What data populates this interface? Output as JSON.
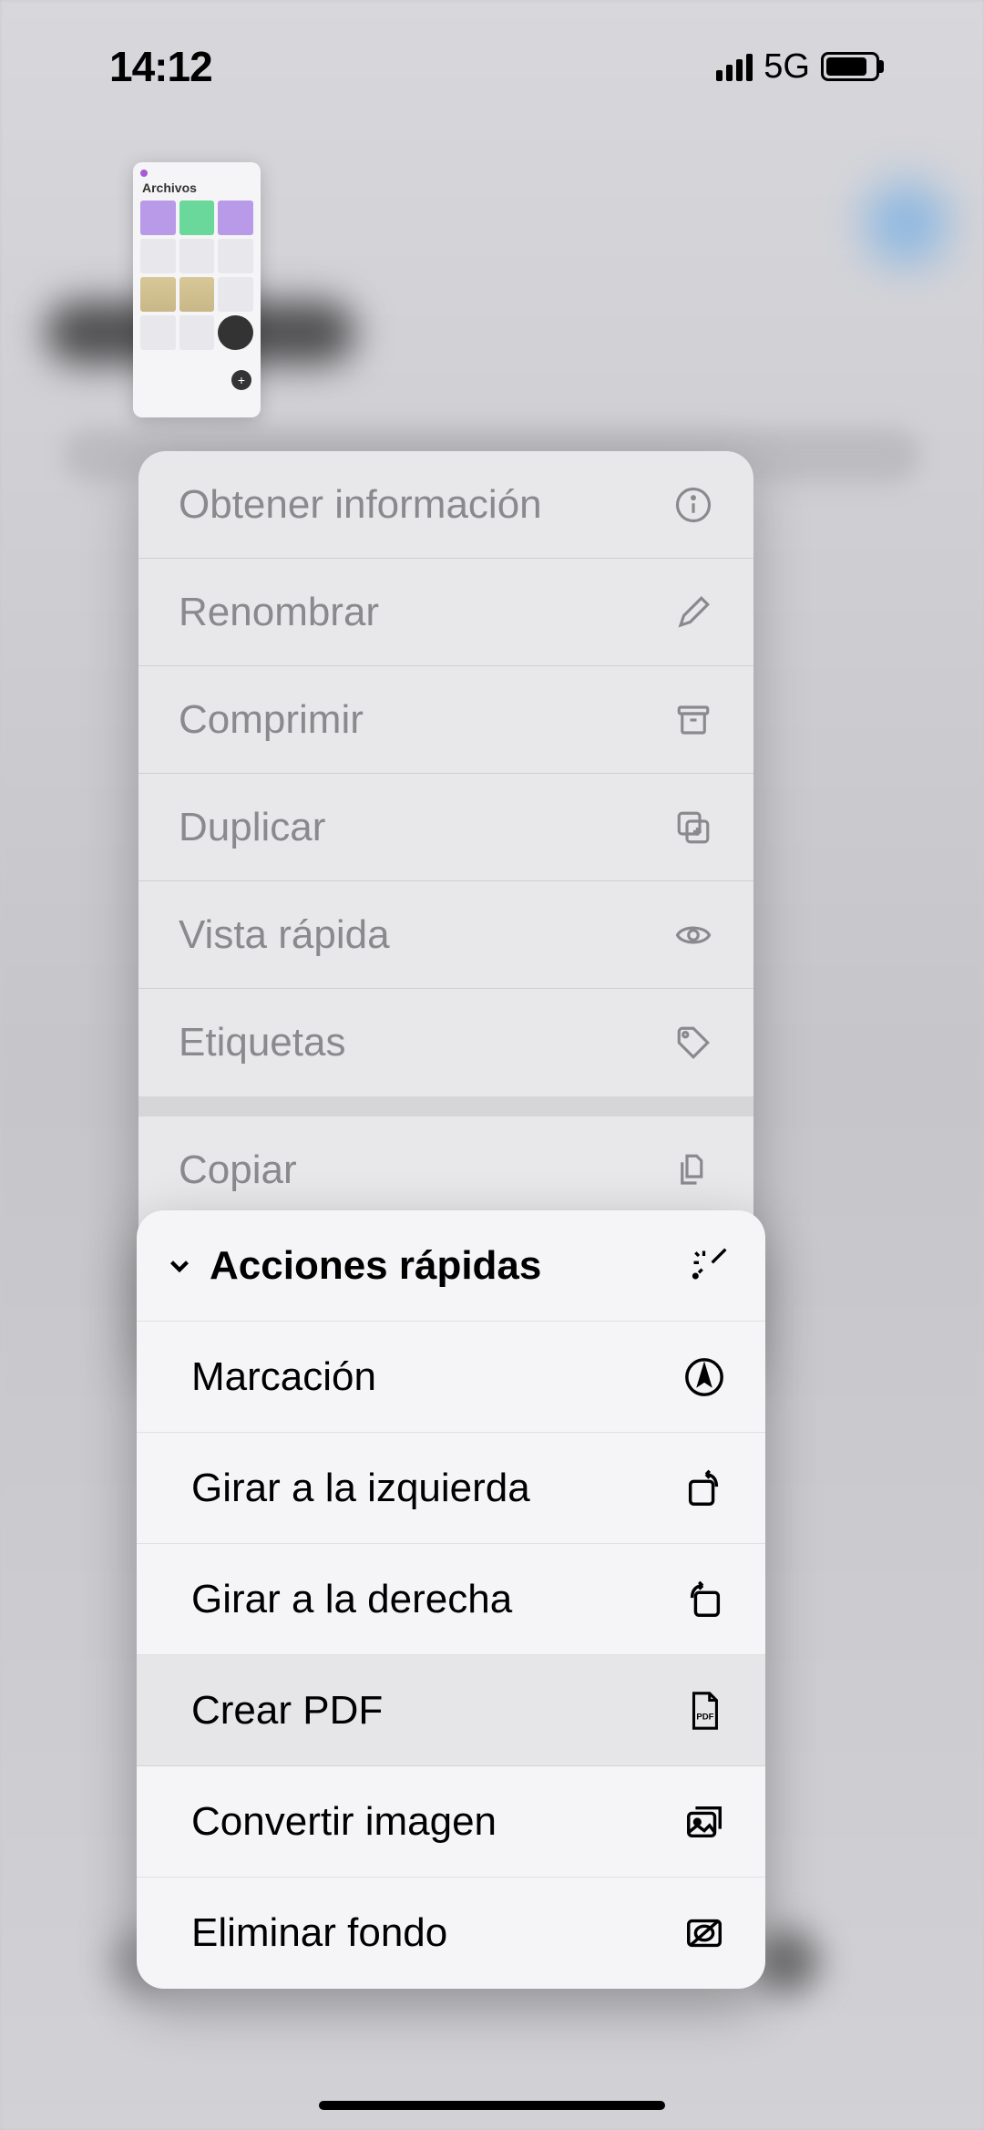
{
  "status": {
    "time": "14:12",
    "network": "5G"
  },
  "thumbnail": {
    "title": "Archivos"
  },
  "menu": {
    "get_info": "Obtener información",
    "rename": "Renombrar",
    "compress": "Comprimir",
    "duplicate": "Duplicar",
    "quick_look": "Vista rápida",
    "tags": "Etiquetas",
    "copy": "Copiar"
  },
  "quick_actions": {
    "title": "Acciones rápidas",
    "markup": "Marcación",
    "rotate_left": "Girar a la izquierda",
    "rotate_right": "Girar a la derecha",
    "create_pdf": "Crear PDF",
    "convert_image": "Convertir imagen",
    "remove_bg": "Eliminar fondo"
  }
}
